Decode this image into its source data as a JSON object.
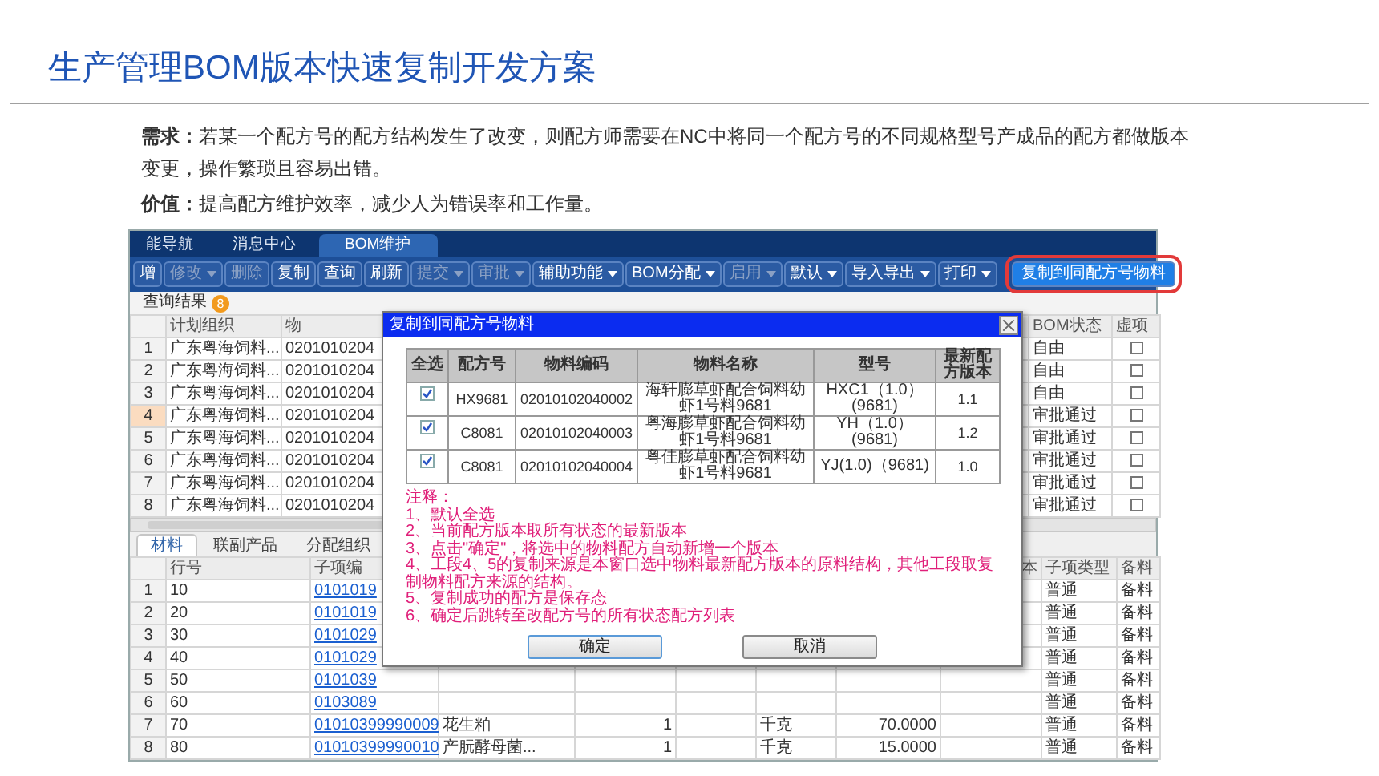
{
  "slide": {
    "title": "生产管理BOM版本快速复制开发方案",
    "paragraphs": [
      "**需求：**若某一个配方号的配方结构发生了改变，则配方师需要在NC中将同一个配方号的不同规格型号产成品的配方都做版本变更，操作繁琐且容易出错。",
      "**价值：**提高配方维护效率，减少人为错误率和工作量。"
    ]
  },
  "app": {
    "tabs": [
      {
        "label": "能导航",
        "selected": false
      },
      {
        "label": "消息中心",
        "selected": false
      },
      {
        "label": "BOM维护",
        "selected": true
      }
    ],
    "toolbar": [
      {
        "label": "增",
        "disabled": false,
        "dropdown": false,
        "highlighted": false
      },
      {
        "label": "修改",
        "disabled": true,
        "dropdown": true,
        "highlighted": false
      },
      {
        "label": "删除",
        "disabled": true,
        "dropdown": false,
        "highlighted": false
      },
      {
        "label": "复制",
        "disabled": false,
        "dropdown": false,
        "highlighted": false
      },
      {
        "label": "查询",
        "disabled": false,
        "dropdown": false,
        "highlighted": false
      },
      {
        "label": "刷新",
        "disabled": false,
        "dropdown": false,
        "highlighted": false
      },
      {
        "label": "提交",
        "disabled": true,
        "dropdown": true,
        "highlighted": false
      },
      {
        "label": "审批",
        "disabled": true,
        "dropdown": true,
        "highlighted": false
      },
      {
        "label": "辅助功能",
        "disabled": false,
        "dropdown": true,
        "highlighted": false
      },
      {
        "label": "BOM分配",
        "disabled": false,
        "dropdown": true,
        "highlighted": false
      },
      {
        "label": "启用",
        "disabled": true,
        "dropdown": true,
        "highlighted": false
      },
      {
        "label": "默认",
        "disabled": false,
        "dropdown": true,
        "highlighted": false
      },
      {
        "label": "导入导出",
        "disabled": false,
        "dropdown": true,
        "highlighted": false
      },
      {
        "label": "打印",
        "disabled": false,
        "dropdown": true,
        "highlighted": false
      },
      {
        "label": "复制到同配方号物料",
        "disabled": false,
        "dropdown": false,
        "highlighted": true
      }
    ],
    "result": {
      "label": "查询结果",
      "count": "8"
    },
    "upper_table": {
      "columns": [
        "计划组织",
        "物",
        "BOM状态",
        "虚项"
      ],
      "rows": [
        {
          "number": "1",
          "org": "广东粤海饲料...",
          "code": "0201010204",
          "bom_status": "自由",
          "virtual": false,
          "selected": false
        },
        {
          "number": "2",
          "org": "广东粤海饲料...",
          "code": "0201010204",
          "bom_status": "自由",
          "virtual": false,
          "selected": false
        },
        {
          "number": "3",
          "org": "广东粤海饲料...",
          "code": "0201010204",
          "bom_status": "自由",
          "virtual": false,
          "selected": false
        },
        {
          "number": "4",
          "org": "广东粤海饲料...",
          "code": "0201010204",
          "bom_status": "审批通过",
          "virtual": false,
          "selected": true
        },
        {
          "number": "5",
          "org": "广东粤海饲料...",
          "code": "0201010204",
          "bom_status": "审批通过",
          "virtual": false,
          "selected": false
        },
        {
          "number": "6",
          "org": "广东粤海饲料...",
          "code": "0201010204",
          "bom_status": "审批通过",
          "virtual": false,
          "selected": false
        },
        {
          "number": "7",
          "org": "广东粤海饲料...",
          "code": "0201010204",
          "bom_status": "审批通过",
          "virtual": false,
          "selected": false
        },
        {
          "number": "8",
          "org": "广东粤海饲料...",
          "code": "0201010204",
          "bom_status": "审批通过",
          "virtual": false,
          "selected": false
        }
      ]
    },
    "detail_tabs": [
      {
        "label": "材料",
        "selected": true
      },
      {
        "label": "联副产品",
        "selected": false
      },
      {
        "label": "分配组织",
        "selected": false
      }
    ],
    "lower_table": {
      "columns": [
        "行号",
        "子项编",
        "本",
        "子项类型",
        "备料"
      ],
      "rows": [
        {
          "number": "1",
          "line": "10",
          "code": "0101019",
          "item_type": "普通",
          "prep": "备料"
        },
        {
          "number": "2",
          "line": "20",
          "code": "0101019",
          "item_type": "普通",
          "prep": "备料"
        },
        {
          "number": "3",
          "line": "30",
          "code": "0101029",
          "item_type": "普通",
          "prep": "备料"
        },
        {
          "number": "4",
          "line": "40",
          "code": "0101029",
          "item_type": "普通",
          "prep": "备料"
        },
        {
          "number": "5",
          "line": "50",
          "code": "0101039",
          "item_type": "普通",
          "prep": "备料"
        },
        {
          "number": "6",
          "line": "60",
          "code": "0103089",
          "item_type": "普通",
          "prep": "备料"
        },
        {
          "number": "7",
          "line": "70",
          "code": "01010399990009",
          "name": "花生粕",
          "quantity": "1",
          "unit": "千克",
          "amount": "70.0000",
          "item_type": "普通",
          "prep": "备料"
        },
        {
          "number": "8",
          "line": "80",
          "code": "01010399990010",
          "name": "产朊酵母菌...",
          "quantity": "1",
          "unit": "千克",
          "amount": "15.0000",
          "item_type": "普通",
          "prep": "备料"
        }
      ]
    },
    "dialog": {
      "title": "复制到同配方号物料",
      "columns": [
        "全选",
        "配方号",
        "物料编码",
        "物料名称",
        "型号",
        "最新配方版本"
      ],
      "rows": [
        {
          "checked": true,
          "formula": "HX9681",
          "code": "02010102040002",
          "name": "海轩膨草虾配合饲料幼虾1号料9681",
          "model": "HXC1（1.0）(9681)",
          "version": "1.1"
        },
        {
          "checked": true,
          "formula": "C8081",
          "code": "02010102040003",
          "name": "粤海膨草虾配合饲料幼虾1号料9681",
          "model": "YH（1.0）(9681)",
          "version": "1.2"
        },
        {
          "checked": true,
          "formula": "C8081",
          "code": "02010102040004",
          "name": "粤佳膨草虾配合饲料幼虾1号料9681",
          "model": "YJ(1.0)（9681)",
          "version": "1.0"
        }
      ],
      "notes": [
        "注释：",
        "1、默认全选",
        "2、当前配方版本取所有状态的最新版本",
        "3、点击\"确定\"，将选中的物料配方自动新增一个版本",
        "4、工段4、5的复制来源是本窗口选中物料最新配方版本的原料结构，其他工段取复制物料配方来源的结构。",
        "5、复制成功的配方是保存态",
        "6、确定后跳转至改配方号的所有状态配方列表"
      ],
      "buttons": [
        "确定",
        "取消"
      ]
    }
  }
}
